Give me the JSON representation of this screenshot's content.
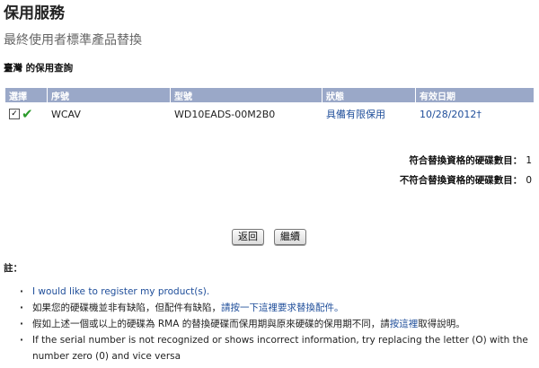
{
  "page_title": "保用服務",
  "subtitle": "最終使用者標準產品替換",
  "section_title": "臺灣 的保用查詢",
  "table": {
    "headers": [
      "選擇",
      "序號",
      "型號",
      "狀態",
      "有效日期"
    ],
    "rows": [
      {
        "checked": true,
        "serial": "WCAV",
        "model": "WD10EADS-00M2B0",
        "status": "具備有限保用",
        "expiry": "10/28/2012†"
      }
    ]
  },
  "counts": {
    "eligible_label": "符合替換資格的硬碟數目：",
    "eligible_value": "1",
    "ineligible_label": "不符合替換資格的硬碟數目：",
    "ineligible_value": "0"
  },
  "buttons": {
    "back": "返回",
    "continue": "繼續"
  },
  "notes": {
    "label": "註：",
    "register_link": "I would like to register my product(s).",
    "line2_text": "如果您的硬碟機並非有缺陷，但配件有缺陷，",
    "line2_link": "請按一下這裡要求替換配件。",
    "line3_text": "假如上述一個或以上的硬碟為 RMA 的替換硬碟而保用期與原來硬碟的保用期不同，請",
    "line3_link": "按這裡",
    "line3_tail": "取得說明。",
    "line4": "If the serial number is not recognized or shows incorrect information, try replacing the letter (O) with the number zero (0) and vice versa"
  },
  "colors": {
    "header_bg": "#9aa8c8",
    "link": "#1f4e9a",
    "check": "#2a9a2a"
  }
}
